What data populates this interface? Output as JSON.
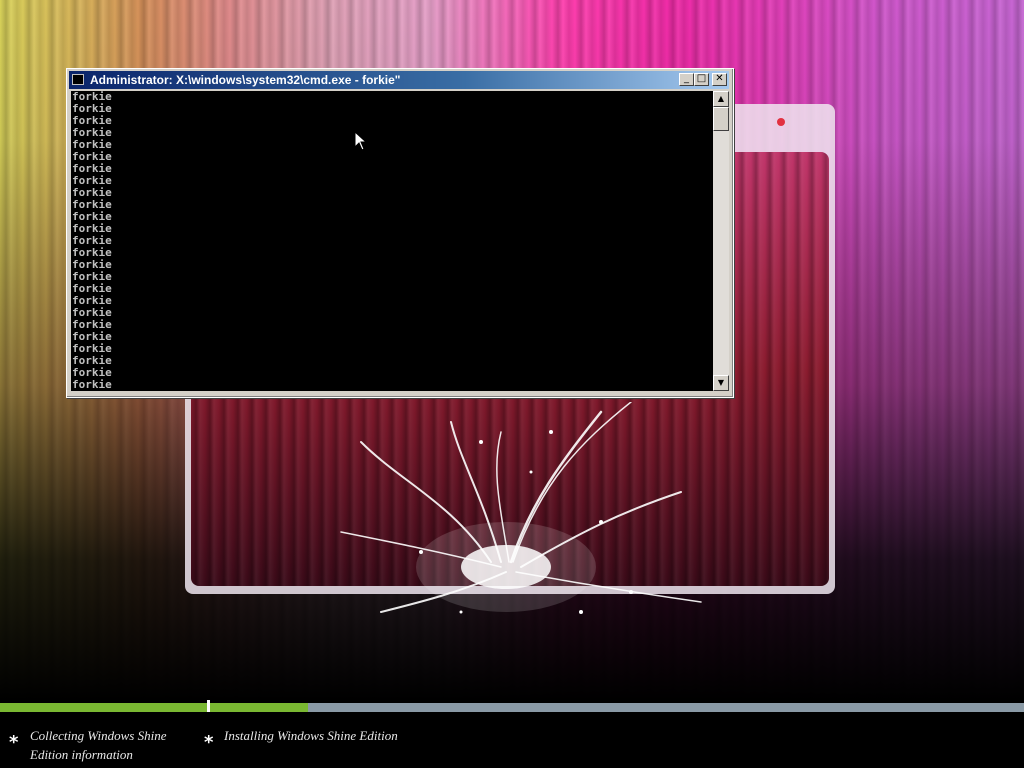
{
  "cmd_window": {
    "title": "Administrator: X:\\windows\\system32\\cmd.exe - forkie\"",
    "minimize_glyph": "_",
    "maximize_glyph": "□",
    "close_glyph": "✕",
    "output_lines": [
      "forkie",
      "forkie",
      "forkie",
      "forkie",
      "forkie",
      "forkie",
      "forkie",
      "forkie",
      "forkie",
      "forkie",
      "forkie",
      "forkie",
      "forkie",
      "forkie",
      "forkie",
      "forkie",
      "forkie",
      "forkie",
      "forkie",
      "forkie",
      "forkie",
      "forkie",
      "forkie",
      "forkie",
      "forkie"
    ],
    "scroll_up_glyph": "▲",
    "scroll_down_glyph": "▼"
  },
  "setup": {
    "progress": [
      {
        "fraction": 1.0
      },
      {
        "fraction": 0.12
      }
    ],
    "steps": [
      {
        "bullet": "*",
        "label_line1": "Collecting Windows Shine",
        "label_line2": "Edition information"
      },
      {
        "bullet": "*",
        "label_line1": "Installing Windows Shine Edition",
        "label_line2": ""
      }
    ]
  },
  "icons": {
    "cursor": "mouse-pointer-icon",
    "cmd": "console-icon"
  },
  "colors": {
    "progress_fill": "#7ab832",
    "progress_track": "#8a9aa6",
    "titlebar": "#0a246a"
  }
}
